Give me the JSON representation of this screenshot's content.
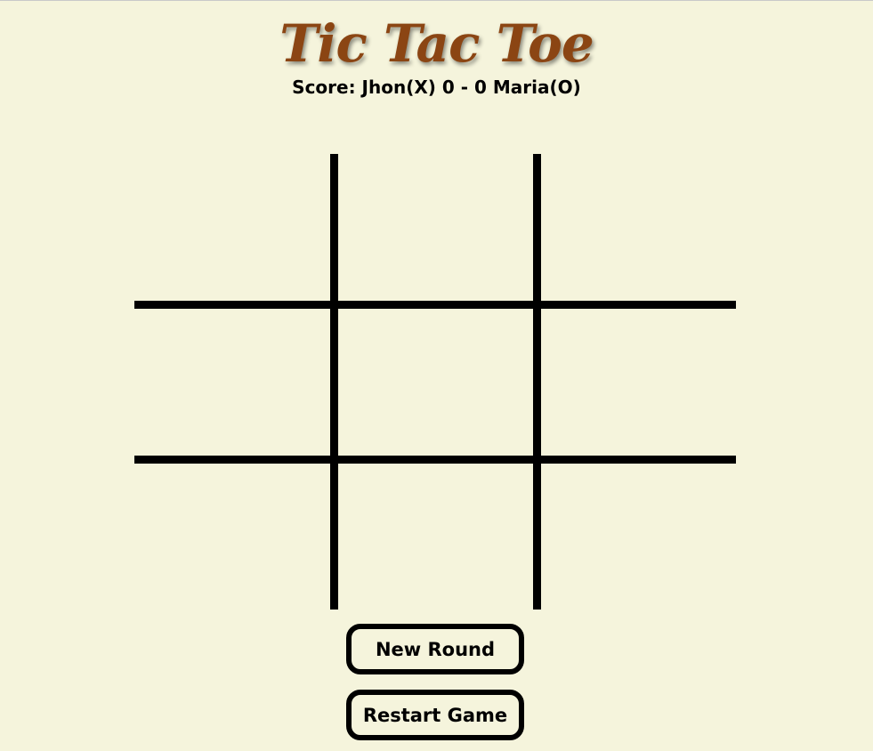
{
  "title": "Tic Tac Toe",
  "score": {
    "text": "Score: Jhon(X) 0 - 0 Maria(O)"
  },
  "board": {
    "cells": [
      "",
      "",
      "",
      "",
      "",
      "",
      "",
      "",
      ""
    ]
  },
  "buttons": {
    "new_round": "New Round",
    "restart_game": "Restart Game"
  },
  "colors": {
    "background": "#f5f4dc",
    "title": "#8b4513",
    "lines": "#000000"
  }
}
